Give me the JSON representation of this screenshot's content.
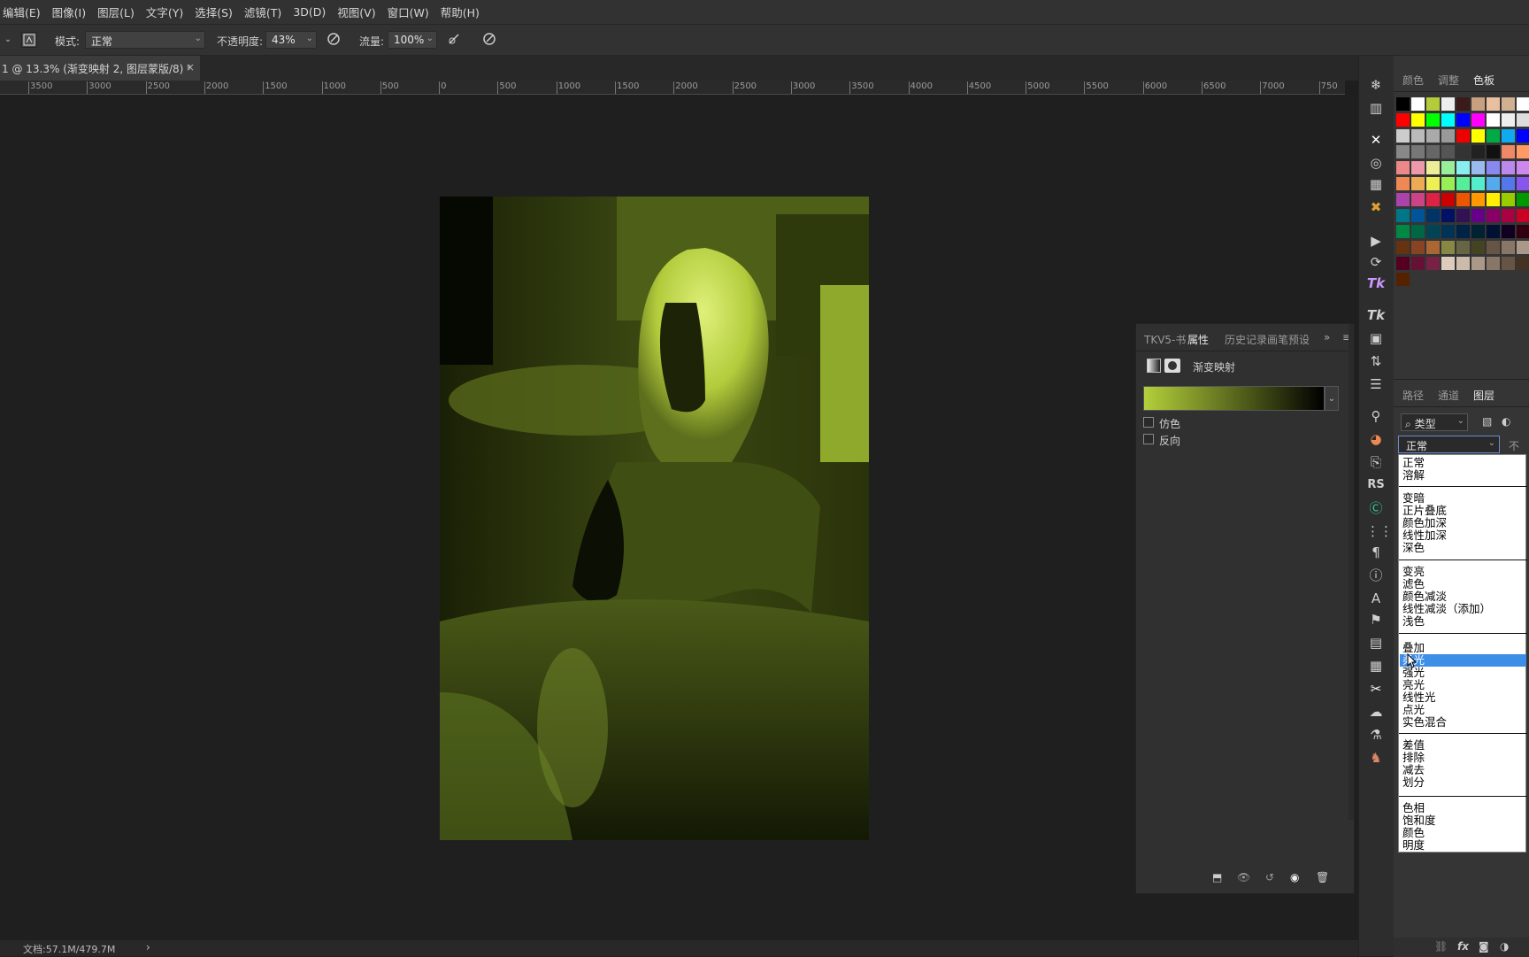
{
  "menubar": {
    "items": [
      "编辑(E)",
      "图像(I)",
      "图层(L)",
      "文字(Y)",
      "选择(S)",
      "滤镜(T)",
      "3D(D)",
      "视图(V)",
      "窗口(W)",
      "帮助(H)"
    ]
  },
  "options": {
    "mode_label": "模式:",
    "mode_value": "正常",
    "opacity_label": "不透明度:",
    "opacity_value": "43%",
    "flow_label": "流量:",
    "flow_value": "100%"
  },
  "document": {
    "tab_title": "1 @ 13.3% (渐变映射 2, 图层蒙版/8) *",
    "close": "×"
  },
  "ruler": {
    "labels": [
      "3500",
      "3000",
      "2500",
      "2000",
      "1500",
      "1000",
      "500",
      "0",
      "500",
      "1000",
      "1500",
      "2000",
      "2500",
      "3000",
      "3500",
      "4000",
      "4500",
      "5000",
      "5500",
      "6000",
      "6500",
      "7000",
      "750"
    ]
  },
  "properties": {
    "tabs": [
      "TKV5-书",
      "属性",
      "历史记录",
      "画笔预设"
    ],
    "active_tab": "属性",
    "adjustment_title": "渐变映射",
    "dither_label": "仿色",
    "reverse_label": "反向",
    "gradient_colors": [
      "#b4d03a",
      "#000000"
    ]
  },
  "swatches": {
    "tabs": [
      "颜色",
      "调整",
      "色板"
    ],
    "active_tab": "色板"
  },
  "layers": {
    "tabs": [
      "路径",
      "通道",
      "图层"
    ],
    "active_tab": "图层",
    "filter_label": "类型",
    "blend_value": "正常",
    "opacity_clip": "不透"
  },
  "blend_modes": {
    "groups": [
      [
        "正常",
        "溶解"
      ],
      [
        "变暗",
        "正片叠底",
        "颜色加深",
        "线性加深",
        "深色"
      ],
      [
        "变亮",
        "滤色",
        "颜色减淡",
        "线性减淡（添加）",
        "浅色"
      ],
      [
        "叠加",
        "柔光",
        "强光",
        "亮光",
        "线性光",
        "点光",
        "实色混合"
      ],
      [
        "差值",
        "排除",
        "减去",
        "划分"
      ],
      [
        "色相",
        "饱和度",
        "颜色",
        "明度"
      ]
    ],
    "highlighted": "柔光"
  },
  "status": {
    "doc_info": "文档:57.1M/479.7M",
    "arrow": "›"
  },
  "colors": {
    "accent": "#3d8ee6",
    "photo_tint": "#b4d03a"
  }
}
